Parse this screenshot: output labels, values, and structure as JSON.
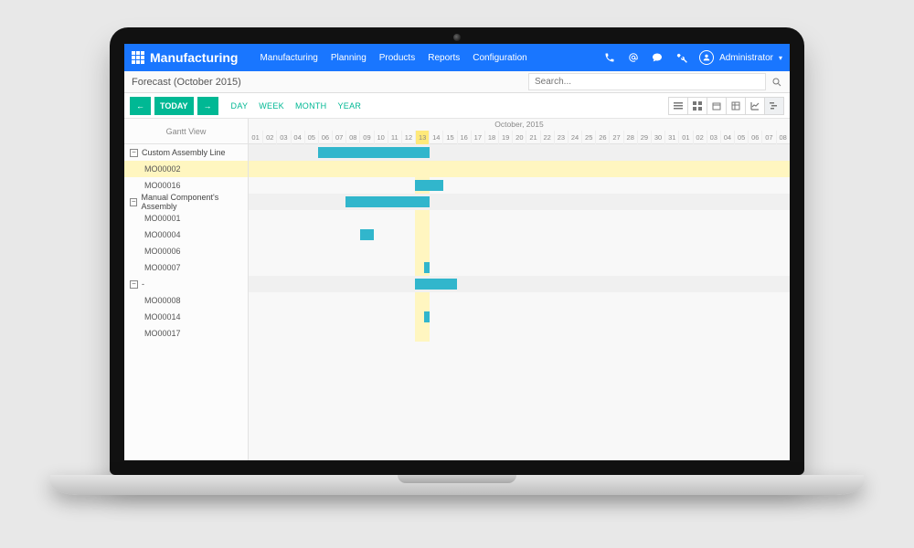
{
  "nav": {
    "title": "Manufacturing",
    "menu": [
      "Manufacturing",
      "Planning",
      "Products",
      "Reports",
      "Configuration"
    ],
    "user": "Administrator"
  },
  "subheader": {
    "title": "Forecast (October 2015)",
    "search_placeholder": "Search..."
  },
  "controls": {
    "today": "TODAY",
    "scales": [
      "DAY",
      "WEEK",
      "MONTH",
      "YEAR"
    ]
  },
  "gantt": {
    "left_header": "Gantt View",
    "month_label": "October, 2015",
    "days": [
      "01",
      "02",
      "03",
      "04",
      "05",
      "06",
      "07",
      "08",
      "09",
      "10",
      "11",
      "12",
      "13",
      "14",
      "15",
      "16",
      "17",
      "18",
      "19",
      "20",
      "21",
      "22",
      "23",
      "24",
      "25",
      "26",
      "27",
      "28",
      "29",
      "30",
      "31",
      "01",
      "02",
      "03",
      "04",
      "05",
      "06",
      "07",
      "08"
    ],
    "today_index": 12,
    "groups": [
      {
        "name": "Custom Assembly Line",
        "expanded": true,
        "summary": {
          "start": 5,
          "end": 13
        },
        "rows": [
          {
            "name": "MO00002",
            "highlight": true
          },
          {
            "name": "MO00016",
            "bar": {
              "start": 12,
              "end": 14
            }
          }
        ]
      },
      {
        "name": "Manual Component's Assembly",
        "expanded": true,
        "summary": {
          "start": 7,
          "end": 13
        },
        "rows": [
          {
            "name": "MO00001"
          },
          {
            "name": "MO00004",
            "bar": {
              "start": 8,
              "end": 9
            }
          },
          {
            "name": "MO00006"
          },
          {
            "name": "MO00007",
            "bar": {
              "start": 12.6,
              "end": 13
            }
          }
        ]
      },
      {
        "name": "-",
        "expanded": true,
        "summary": {
          "start": 12,
          "end": 15
        },
        "rows": [
          {
            "name": "MO00008"
          },
          {
            "name": "MO00014",
            "bar": {
              "start": 12.6,
              "end": 13
            }
          },
          {
            "name": "MO00017"
          }
        ]
      }
    ]
  }
}
